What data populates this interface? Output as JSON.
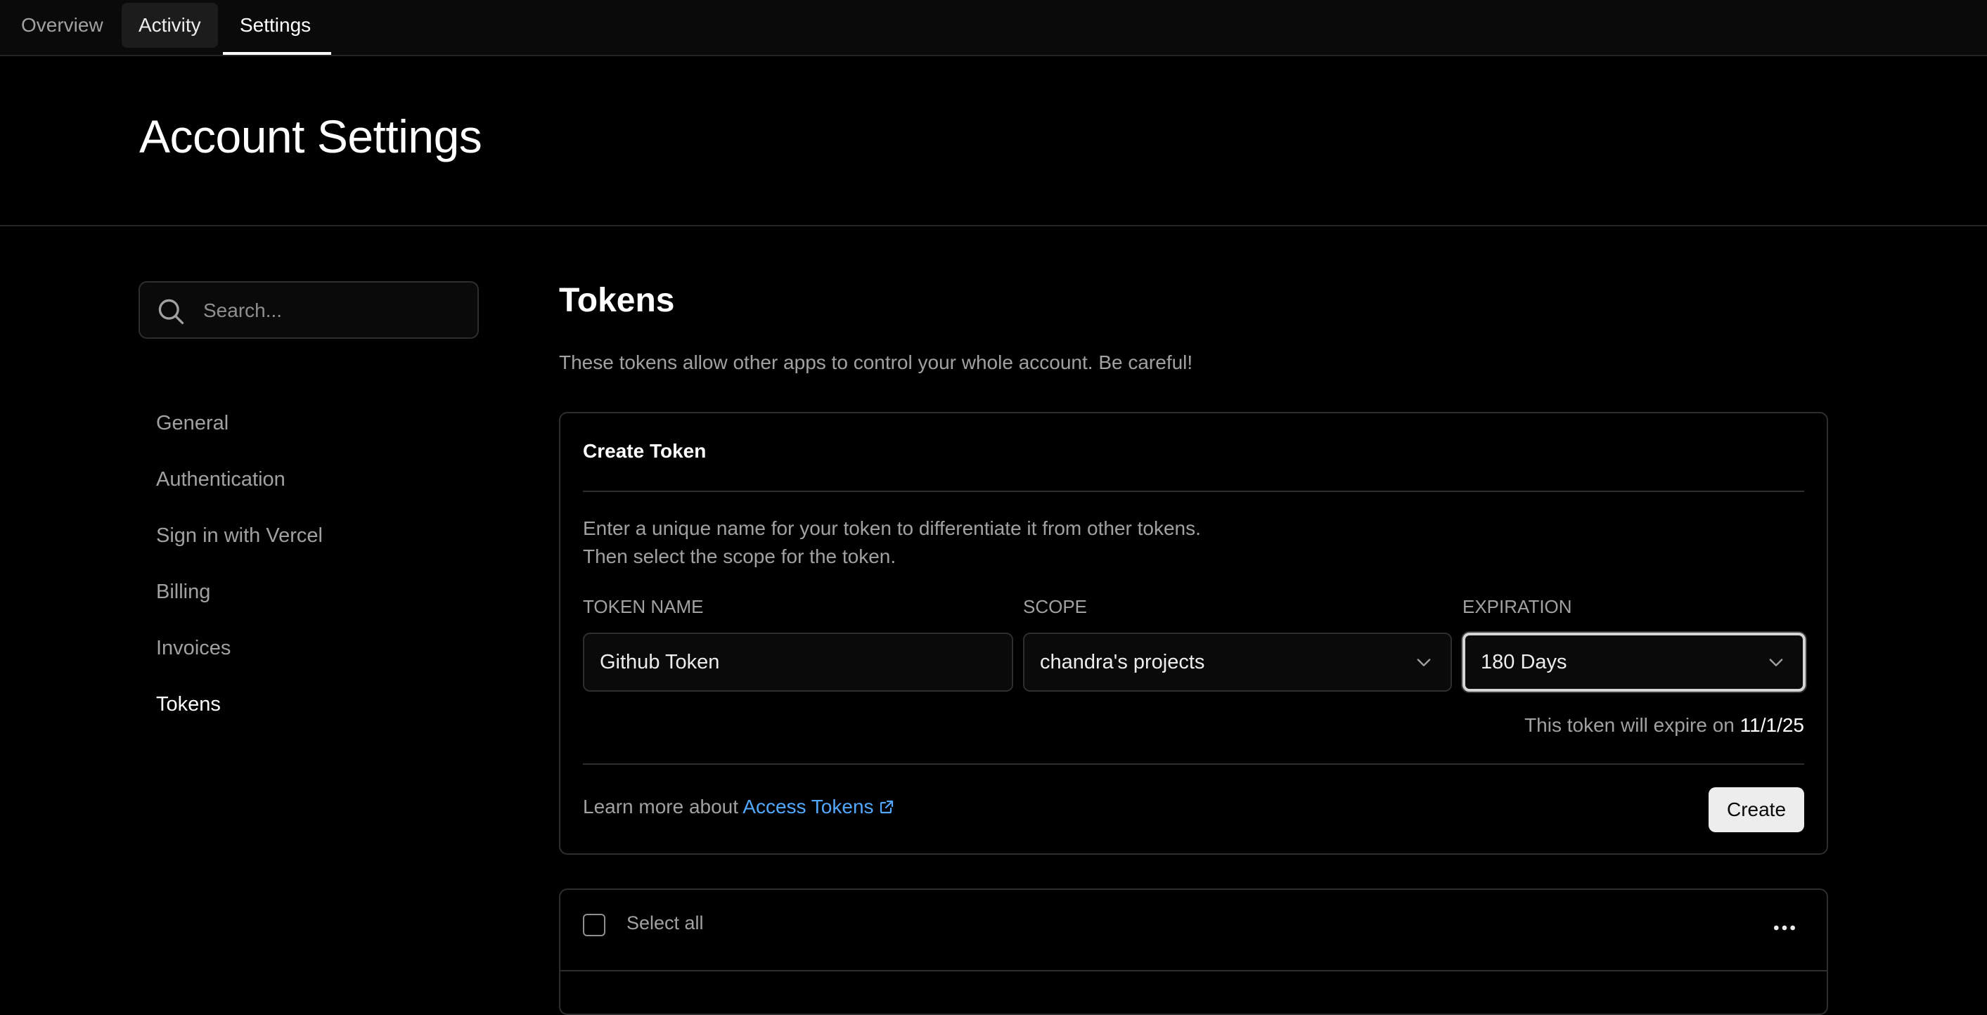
{
  "tabs": [
    {
      "label": "Overview"
    },
    {
      "label": "Activity"
    },
    {
      "label": "Settings"
    }
  ],
  "header": {
    "title": "Account Settings"
  },
  "sidebar": {
    "search_placeholder": "Search...",
    "items": [
      {
        "label": "General"
      },
      {
        "label": "Authentication"
      },
      {
        "label": "Sign in with Vercel"
      },
      {
        "label": "Billing"
      },
      {
        "label": "Invoices"
      },
      {
        "label": "Tokens",
        "active": true
      }
    ]
  },
  "main": {
    "title": "Tokens",
    "description": "These tokens allow other apps to control your whole account. Be careful!",
    "create_card": {
      "title": "Create Token",
      "desc_line1": "Enter a unique name for your token to differentiate it from other tokens.",
      "desc_line2": "Then select the scope for the token.",
      "token_name_label": "TOKEN NAME",
      "token_name_value": "Github Token",
      "scope_label": "SCOPE",
      "scope_value": "chandra's projects",
      "expiration_label": "EXPIRATION",
      "expiration_value": "180 Days",
      "expire_prefix": "This token will expire on",
      "expire_date": "11/1/25",
      "learn_more_prefix": "Learn more about",
      "learn_more_link": "Access Tokens",
      "create_button": "Create"
    },
    "list": {
      "select_all_label": "Select all"
    }
  },
  "icons": {
    "search": "search-icon",
    "chevron": "chevron-down-icon",
    "external": "external-link-icon",
    "more": "more-horizontal-icon"
  },
  "colors": {
    "background": "#000000",
    "link": "#52a8ff",
    "button_bg": "#ededed"
  }
}
